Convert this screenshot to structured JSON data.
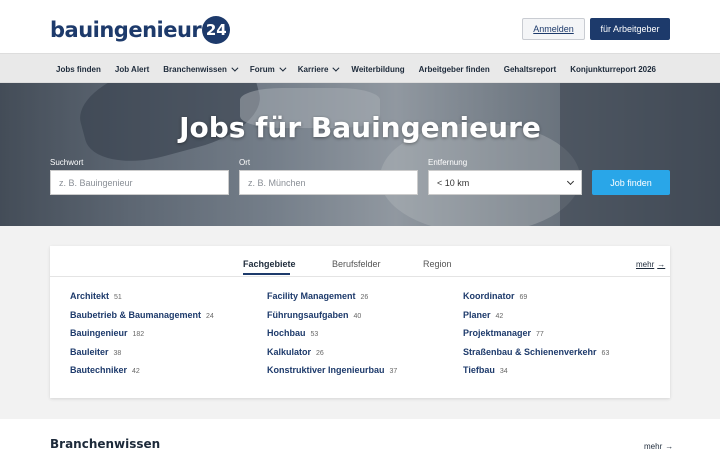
{
  "header": {
    "logo_text": "bauingenieur",
    "logo_badge": "24",
    "login_label": "Anmelden",
    "employer_label": "für Arbeitgeber"
  },
  "nav": {
    "items": [
      {
        "label": "Jobs finden",
        "dropdown": false
      },
      {
        "label": "Job Alert",
        "dropdown": false
      },
      {
        "label": "Branchenwissen",
        "dropdown": true
      },
      {
        "label": "Forum",
        "dropdown": true
      },
      {
        "label": "Karriere",
        "dropdown": true
      },
      {
        "label": "Weiterbildung",
        "dropdown": false
      },
      {
        "label": "Arbeitgeber finden",
        "dropdown": false
      },
      {
        "label": "Gehaltsreport",
        "dropdown": false
      },
      {
        "label": "Konjunkturreport 2026",
        "dropdown": false
      }
    ]
  },
  "hero": {
    "title": "Jobs für Bauingenieure",
    "search_label": "Suchwort",
    "search_placeholder": "z. B. Bauingenieur",
    "location_label": "Ort",
    "location_placeholder": "z. B. München",
    "distance_label": "Entfernung",
    "distance_value": "< 10 km",
    "search_button": "Job finden"
  },
  "card": {
    "tabs": [
      "Fachgebiete",
      "Berufsfelder",
      "Region"
    ],
    "active_tab": "Fachgebiete",
    "more_label": "mehr",
    "columns": [
      [
        {
          "label": "Architekt",
          "count": "51"
        },
        {
          "label": "Baubetrieb & Baumanagement",
          "count": "24"
        },
        {
          "label": "Bauingenieur",
          "count": "182"
        },
        {
          "label": "Bauleiter",
          "count": "38"
        },
        {
          "label": "Bautechniker",
          "count": "42"
        }
      ],
      [
        {
          "label": "Facility Management",
          "count": "26"
        },
        {
          "label": "Führungsaufgaben",
          "count": "40"
        },
        {
          "label": "Hochbau",
          "count": "53"
        },
        {
          "label": "Kalkulator",
          "count": "26"
        },
        {
          "label": "Konstruktiver Ingenieurbau",
          "count": "37"
        }
      ],
      [
        {
          "label": "Koordinator",
          "count": "69"
        },
        {
          "label": "Planer",
          "count": "42"
        },
        {
          "label": "Projektmanager",
          "count": "77"
        },
        {
          "label": "Straßenbau & Schienenverkehr",
          "count": "63"
        },
        {
          "label": "Tiefbau",
          "count": "34"
        }
      ]
    ]
  },
  "bottom": {
    "title": "Branchenwissen",
    "more_label": "mehr"
  },
  "colors": {
    "brand_navy": "#1d3a6b",
    "accent_blue": "#29a6e8"
  }
}
